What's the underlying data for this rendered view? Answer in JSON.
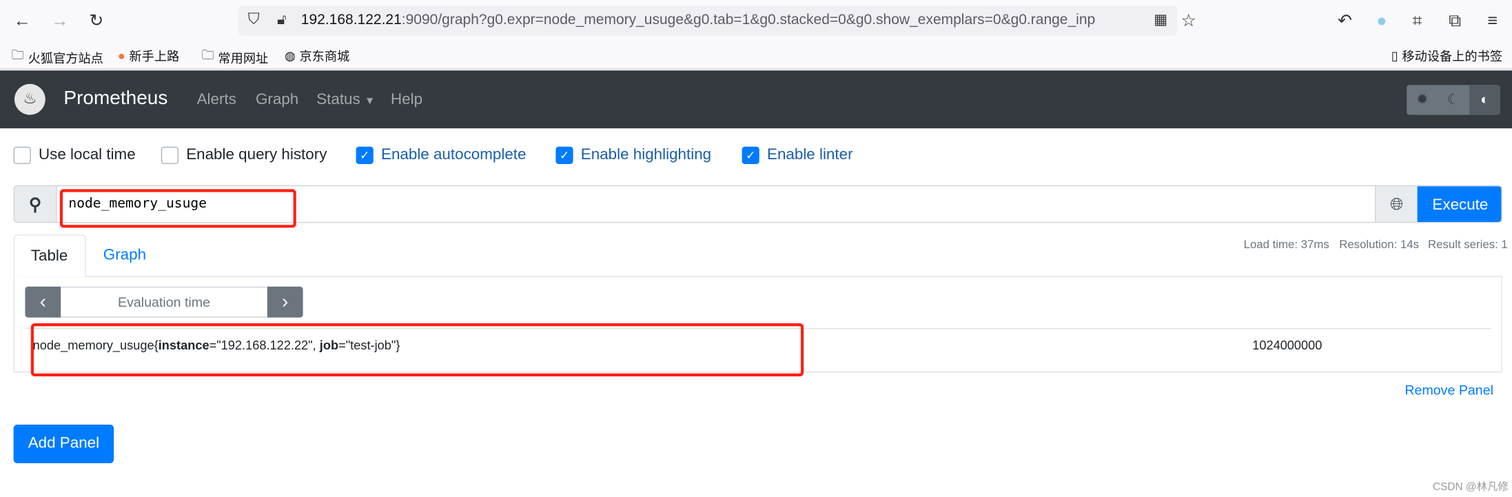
{
  "browser": {
    "url_host": "192.168.122.21",
    "url_rest": ":9090/graph?g0.expr=node_memory_usuge&g0.tab=1&g0.stacked=0&g0.show_exemplars=0&g0.range_inp",
    "bookmarks": [
      "火狐官方站点",
      "新手上路",
      "常用网址",
      "京东商城"
    ],
    "mobile_bookmarks": "移动设备上的书签"
  },
  "navbar": {
    "brand": "Prometheus",
    "links": [
      "Alerts",
      "Graph",
      "Status",
      "Help"
    ]
  },
  "options": [
    {
      "label": "Use local time",
      "checked": false
    },
    {
      "label": "Enable query history",
      "checked": false
    },
    {
      "label": "Enable autocomplete",
      "checked": true
    },
    {
      "label": "Enable highlighting",
      "checked": true
    },
    {
      "label": "Enable linter",
      "checked": true
    }
  ],
  "query": {
    "value": "node_memory_usuge",
    "execute_label": "Execute"
  },
  "tabs": [
    "Table",
    "Graph"
  ],
  "stats": {
    "load_time": "Load time: 37ms",
    "resolution": "Resolution: 14s",
    "result_series": "Result series: 1"
  },
  "eval_time_placeholder": "Evaluation time",
  "result": {
    "metric": "node_memory_usuge",
    "labels": [
      {
        "key": "instance",
        "value": "\"192.168.122.22\""
      },
      {
        "key": "job",
        "value": "\"test-job\""
      }
    ],
    "value": "1024000000"
  },
  "remove_panel": "Remove Panel",
  "add_panel": "Add Panel",
  "watermark": "CSDN @林凡修",
  "colors": {
    "primary": "#007bff",
    "navbar": "#343a40",
    "highlight": "#ff2012"
  }
}
